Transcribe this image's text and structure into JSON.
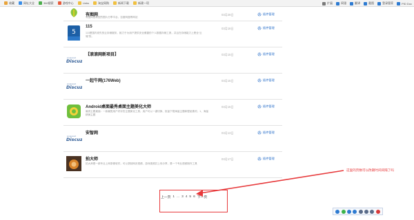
{
  "bookmarks": {
    "left": [
      {
        "label": "收藏",
        "color": "#e8a33a"
      },
      {
        "label": "网址大全",
        "color": "#3a8ee8"
      },
      {
        "label": "360搜索",
        "color": "#4cae4c"
      },
      {
        "label": "游戏中心",
        "color": "#e85a3a"
      },
      {
        "label": "Links",
        "color": "#f0c040"
      },
      {
        "label": "淘宝网购",
        "color": "#f0c040"
      },
      {
        "label": "新闻下载",
        "color": "#f0c040"
      },
      {
        "label": "新建一项",
        "color": "#f0c040"
      }
    ],
    "right": [
      {
        "label": "扩展",
        "color": "#7a7a7a"
      },
      {
        "label": "网银",
        "color": "#2e7bd1"
      },
      {
        "label": "翻译",
        "color": "#2e7bd1"
      },
      {
        "label": "截图",
        "color": "#2e7bd1"
      },
      {
        "label": "登录管家",
        "color": "#2e7bd1"
      },
      {
        "label": "PID Doc",
        "color": "#2e7bd1"
      }
    ]
  },
  "manage_label": "插件管理",
  "rows": [
    {
      "name": "有图网",
      "desc": "有图网是新型的图片分享平台，百度网盘等网站",
      "date": "03月28日",
      "logo": "leaf"
    },
    {
      "name": "115",
      "desc": "115是国内领先的云存储服务，致力于为用户提供安全便捷的个人数据存储工具，并且在存储能力上是全“云端”的。",
      "date": "03月18日",
      "logo": "115"
    },
    {
      "name": "【滚滚网新项目】",
      "desc": "",
      "date": "03月15日",
      "logo": "discuz"
    },
    {
      "name": "一起牛网(176Web)",
      "desc": "",
      "date": "03月15日",
      "logo": "discuz"
    },
    {
      "name": "Android桌面最秀桌面主题美化大师",
      "desc": "最秀主题桌面：一款最受用户好评的主题美化工具，用户可以一键切换、批量下载海量主题和壁纸素材，1、海量精美主题",
      "date": "03月15日",
      "logo": "android"
    },
    {
      "name": "安智网",
      "desc": "",
      "date": "03月13日",
      "logo": "discuz"
    },
    {
      "name": "拍大师",
      "desc": "拍大师是一款专业上网录像软件，可以录制网页视频、游戏视频并上传分享，是一个专业视频制作工具",
      "date": "03月17日",
      "logo": "photo"
    }
  ],
  "pager": {
    "prev": "上一页",
    "pages": [
      "1",
      "...",
      "3",
      "4",
      "5",
      "6"
    ],
    "next": "下一页"
  },
  "annotation": {
    "text": "这里的页数可以改期时间间隔了吗",
    "color": "#e7383a"
  },
  "tray_icons": [
    "ie-icon",
    "weixin-icon",
    "qq-icon",
    "chat-icon",
    "monitor-icon",
    "print-icon",
    "settings-icon",
    "close-icon"
  ]
}
